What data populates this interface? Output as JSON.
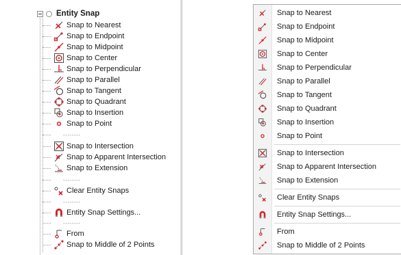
{
  "tree": {
    "root_label": "Entity Snap",
    "items": [
      {
        "label": "Snap to Nearest",
        "icon": "snap-nearest-icon"
      },
      {
        "label": "Snap to Endpoint",
        "icon": "snap-endpoint-icon"
      },
      {
        "label": "Snap to Midpoint",
        "icon": "snap-midpoint-icon"
      },
      {
        "label": "Snap to Center",
        "icon": "snap-center-icon"
      },
      {
        "label": "Snap to Perpendicular",
        "icon": "snap-perpendicular-icon"
      },
      {
        "label": "Snap to Parallel",
        "icon": "snap-parallel-icon"
      },
      {
        "label": "Snap to Tangent",
        "icon": "snap-tangent-icon"
      },
      {
        "label": "Snap to Quadrant",
        "icon": "snap-quadrant-icon"
      },
      {
        "label": "Snap to Insertion",
        "icon": "snap-insertion-icon"
      },
      {
        "label": "Snap to Point",
        "icon": "snap-point-icon"
      },
      {
        "label": "Snap to Intersection",
        "icon": "snap-intersection-icon"
      },
      {
        "label": "Snap to Apparent Intersection",
        "icon": "snap-apparent-intersection-icon"
      },
      {
        "label": "Snap to Extension",
        "icon": "snap-extension-icon"
      },
      {
        "label": "Clear Entity Snaps",
        "icon": "clear-snaps-icon"
      },
      {
        "label": "Entity Snap Settings...",
        "icon": "magnet-icon"
      },
      {
        "label": "From",
        "icon": "from-icon"
      },
      {
        "label": "Snap to Middle of 2 Points",
        "icon": "snap-middle-two-points-icon"
      }
    ],
    "separator_text": "--------"
  },
  "menu": {
    "items": [
      {
        "label": "Snap to Nearest",
        "icon": "snap-nearest-icon"
      },
      {
        "label": "Snap to Endpoint",
        "icon": "snap-endpoint-icon"
      },
      {
        "label": "Snap to Midpoint",
        "icon": "snap-midpoint-icon"
      },
      {
        "label": "Snap to Center",
        "icon": "snap-center-icon"
      },
      {
        "label": "Snap to Perpendicular",
        "icon": "snap-perpendicular-icon"
      },
      {
        "label": "Snap to Parallel",
        "icon": "snap-parallel-icon"
      },
      {
        "label": "Snap to Tangent",
        "icon": "snap-tangent-icon"
      },
      {
        "label": "Snap to Quadrant",
        "icon": "snap-quadrant-icon"
      },
      {
        "label": "Snap to Insertion",
        "icon": "snap-insertion-icon"
      },
      {
        "label": "Snap to Point",
        "icon": "snap-point-icon"
      },
      {
        "label": "Snap to Intersection",
        "icon": "snap-intersection-icon"
      },
      {
        "label": "Snap to Apparent Intersection",
        "icon": "snap-apparent-intersection-icon"
      },
      {
        "label": "Snap to Extension",
        "icon": "snap-extension-icon"
      },
      {
        "label": "Clear Entity Snaps",
        "icon": "clear-snaps-icon"
      },
      {
        "label": "Entity Snap Settings...",
        "icon": "magnet-icon"
      },
      {
        "label": "From",
        "icon": "from-icon"
      },
      {
        "label": "Snap to Middle of 2 Points",
        "icon": "snap-middle-two-points-icon"
      }
    ]
  },
  "colors": {
    "icon_red": "#d8232a",
    "icon_dark": "#4a4a4a",
    "text": "#1a1a1a",
    "separator": "#d4d4d4"
  }
}
